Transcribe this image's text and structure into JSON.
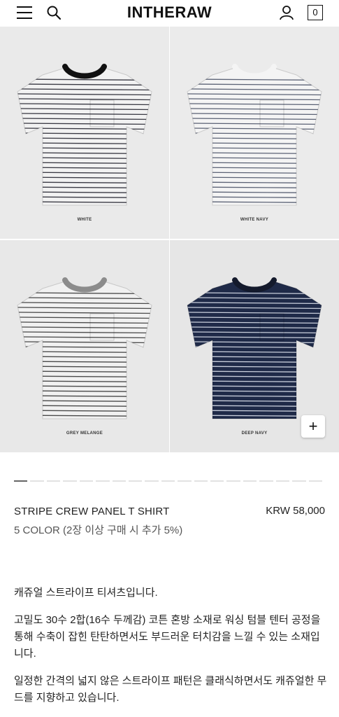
{
  "header": {
    "logo": "INTHERAW",
    "cart_count": "0"
  },
  "gallery": {
    "items": [
      {
        "label": "WHITE",
        "collar": "#111111",
        "body": "#f2f2f2",
        "stripe": "#3a3a44"
      },
      {
        "label": "WHITE NAVY",
        "collar": "#f4f4f4",
        "body": "#f4f4f4",
        "stripe": "#5b6275"
      },
      {
        "label": "GREY MELANGE",
        "collar": "#8c8c8c",
        "body": "#f1f1f1",
        "stripe": "#4a4a4a"
      },
      {
        "label": "DEEP NAVY",
        "collar": "#141a2c",
        "body": "#1f2a48",
        "stripe": "#c9cfdc"
      }
    ],
    "add_button": "+"
  },
  "pager": {
    "total": 19,
    "active": 0
  },
  "product": {
    "name": "STRIPE CREW PANEL T SHIRT",
    "price": "KRW 58,000",
    "color_info": "5 COLOR (2장 이상 구매 시 추가 5%)"
  },
  "description": {
    "p1": "캐쥬얼 스트라이프 티셔츠입니다.",
    "p2": "고밀도 30수 2합(16수 두께감) 코튼 혼방 소재로 워싱 텀블 텐터 공정을 통해 수축이 잡힌 탄탄하면서도 부드러운 터치감을 느낄 수 있는 소재입니다.",
    "p3": "일정한 간격의 넓지 않은 스트라이프 패턴은 클래식하면서도 캐쥬얼한 무드를 지향하고 있습니다."
  }
}
